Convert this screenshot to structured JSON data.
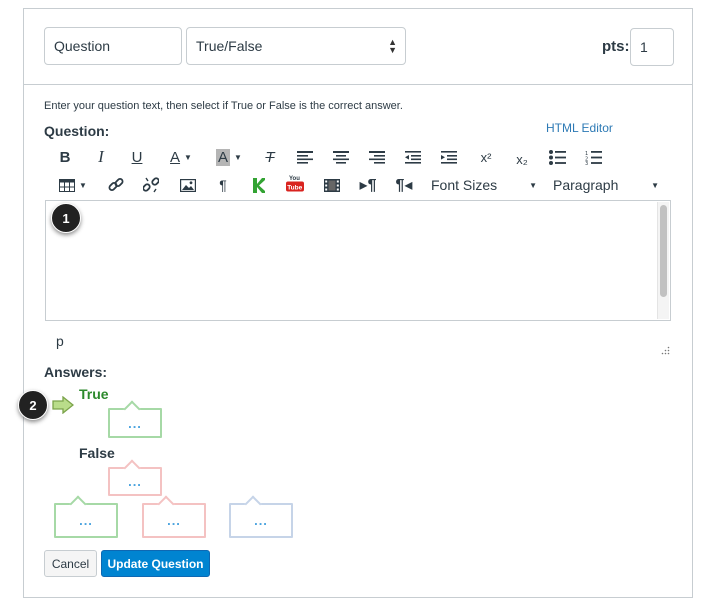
{
  "header": {
    "question_name": "Question",
    "question_type": "True/False",
    "points_label": "pts:",
    "points_value": "1"
  },
  "instructions": "Enter your question text, then select if True or False is the correct answer.",
  "question_label": "Question:",
  "html_editor_link": "HTML Editor",
  "toolbar": {
    "font_sizes_label": "Font Sizes",
    "paragraph_label": "Paragraph",
    "bold_glyph": "B",
    "italic_glyph": "I",
    "underline_glyph": "U",
    "font_color_glyph": "A",
    "bg_color_glyph": "A",
    "clear_format_glyph": "T",
    "superscript_glyph": "x²",
    "subscript_glyph": "x₂"
  },
  "editor": {
    "path_indicator": "p"
  },
  "callouts": {
    "one": "1",
    "two": "2"
  },
  "answers": {
    "label": "Answers:",
    "true_label": "True",
    "false_label": "False",
    "ellipsis": "..."
  },
  "buttons": {
    "cancel": "Cancel",
    "update": "Update Question"
  },
  "colors": {
    "correct_answer": "#2c8a2c",
    "primary_button": "#0084d1",
    "link": "#2d7ab5"
  }
}
